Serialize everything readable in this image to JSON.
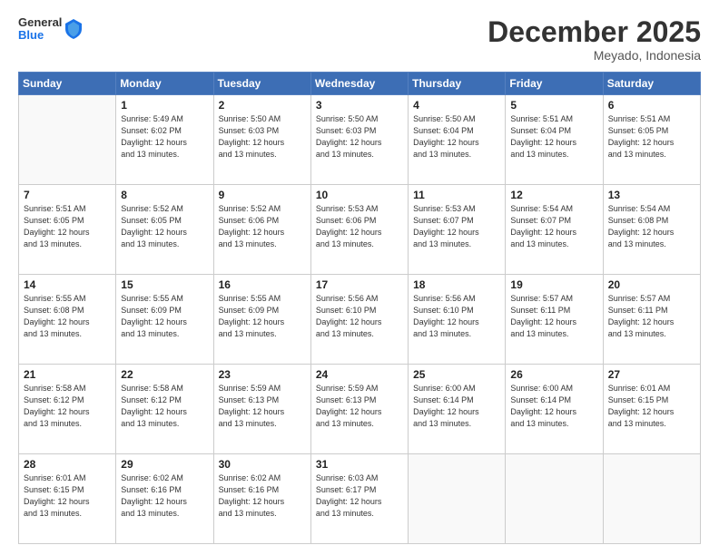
{
  "logo": {
    "general": "General",
    "blue": "Blue"
  },
  "header": {
    "month": "December 2025",
    "location": "Meyado, Indonesia"
  },
  "weekdays": [
    "Sunday",
    "Monday",
    "Tuesday",
    "Wednesday",
    "Thursday",
    "Friday",
    "Saturday"
  ],
  "weeks": [
    [
      {
        "day": "",
        "info": ""
      },
      {
        "day": "1",
        "info": "Sunrise: 5:49 AM\nSunset: 6:02 PM\nDaylight: 12 hours\nand 13 minutes."
      },
      {
        "day": "2",
        "info": "Sunrise: 5:50 AM\nSunset: 6:03 PM\nDaylight: 12 hours\nand 13 minutes."
      },
      {
        "day": "3",
        "info": "Sunrise: 5:50 AM\nSunset: 6:03 PM\nDaylight: 12 hours\nand 13 minutes."
      },
      {
        "day": "4",
        "info": "Sunrise: 5:50 AM\nSunset: 6:04 PM\nDaylight: 12 hours\nand 13 minutes."
      },
      {
        "day": "5",
        "info": "Sunrise: 5:51 AM\nSunset: 6:04 PM\nDaylight: 12 hours\nand 13 minutes."
      },
      {
        "day": "6",
        "info": "Sunrise: 5:51 AM\nSunset: 6:05 PM\nDaylight: 12 hours\nand 13 minutes."
      }
    ],
    [
      {
        "day": "7",
        "info": "Sunrise: 5:51 AM\nSunset: 6:05 PM\nDaylight: 12 hours\nand 13 minutes."
      },
      {
        "day": "8",
        "info": "Sunrise: 5:52 AM\nSunset: 6:05 PM\nDaylight: 12 hours\nand 13 minutes."
      },
      {
        "day": "9",
        "info": "Sunrise: 5:52 AM\nSunset: 6:06 PM\nDaylight: 12 hours\nand 13 minutes."
      },
      {
        "day": "10",
        "info": "Sunrise: 5:53 AM\nSunset: 6:06 PM\nDaylight: 12 hours\nand 13 minutes."
      },
      {
        "day": "11",
        "info": "Sunrise: 5:53 AM\nSunset: 6:07 PM\nDaylight: 12 hours\nand 13 minutes."
      },
      {
        "day": "12",
        "info": "Sunrise: 5:54 AM\nSunset: 6:07 PM\nDaylight: 12 hours\nand 13 minutes."
      },
      {
        "day": "13",
        "info": "Sunrise: 5:54 AM\nSunset: 6:08 PM\nDaylight: 12 hours\nand 13 minutes."
      }
    ],
    [
      {
        "day": "14",
        "info": "Sunrise: 5:55 AM\nSunset: 6:08 PM\nDaylight: 12 hours\nand 13 minutes."
      },
      {
        "day": "15",
        "info": "Sunrise: 5:55 AM\nSunset: 6:09 PM\nDaylight: 12 hours\nand 13 minutes."
      },
      {
        "day": "16",
        "info": "Sunrise: 5:55 AM\nSunset: 6:09 PM\nDaylight: 12 hours\nand 13 minutes."
      },
      {
        "day": "17",
        "info": "Sunrise: 5:56 AM\nSunset: 6:10 PM\nDaylight: 12 hours\nand 13 minutes."
      },
      {
        "day": "18",
        "info": "Sunrise: 5:56 AM\nSunset: 6:10 PM\nDaylight: 12 hours\nand 13 minutes."
      },
      {
        "day": "19",
        "info": "Sunrise: 5:57 AM\nSunset: 6:11 PM\nDaylight: 12 hours\nand 13 minutes."
      },
      {
        "day": "20",
        "info": "Sunrise: 5:57 AM\nSunset: 6:11 PM\nDaylight: 12 hours\nand 13 minutes."
      }
    ],
    [
      {
        "day": "21",
        "info": "Sunrise: 5:58 AM\nSunset: 6:12 PM\nDaylight: 12 hours\nand 13 minutes."
      },
      {
        "day": "22",
        "info": "Sunrise: 5:58 AM\nSunset: 6:12 PM\nDaylight: 12 hours\nand 13 minutes."
      },
      {
        "day": "23",
        "info": "Sunrise: 5:59 AM\nSunset: 6:13 PM\nDaylight: 12 hours\nand 13 minutes."
      },
      {
        "day": "24",
        "info": "Sunrise: 5:59 AM\nSunset: 6:13 PM\nDaylight: 12 hours\nand 13 minutes."
      },
      {
        "day": "25",
        "info": "Sunrise: 6:00 AM\nSunset: 6:14 PM\nDaylight: 12 hours\nand 13 minutes."
      },
      {
        "day": "26",
        "info": "Sunrise: 6:00 AM\nSunset: 6:14 PM\nDaylight: 12 hours\nand 13 minutes."
      },
      {
        "day": "27",
        "info": "Sunrise: 6:01 AM\nSunset: 6:15 PM\nDaylight: 12 hours\nand 13 minutes."
      }
    ],
    [
      {
        "day": "28",
        "info": "Sunrise: 6:01 AM\nSunset: 6:15 PM\nDaylight: 12 hours\nand 13 minutes."
      },
      {
        "day": "29",
        "info": "Sunrise: 6:02 AM\nSunset: 6:16 PM\nDaylight: 12 hours\nand 13 minutes."
      },
      {
        "day": "30",
        "info": "Sunrise: 6:02 AM\nSunset: 6:16 PM\nDaylight: 12 hours\nand 13 minutes."
      },
      {
        "day": "31",
        "info": "Sunrise: 6:03 AM\nSunset: 6:17 PM\nDaylight: 12 hours\nand 13 minutes."
      },
      {
        "day": "",
        "info": ""
      },
      {
        "day": "",
        "info": ""
      },
      {
        "day": "",
        "info": ""
      }
    ]
  ]
}
